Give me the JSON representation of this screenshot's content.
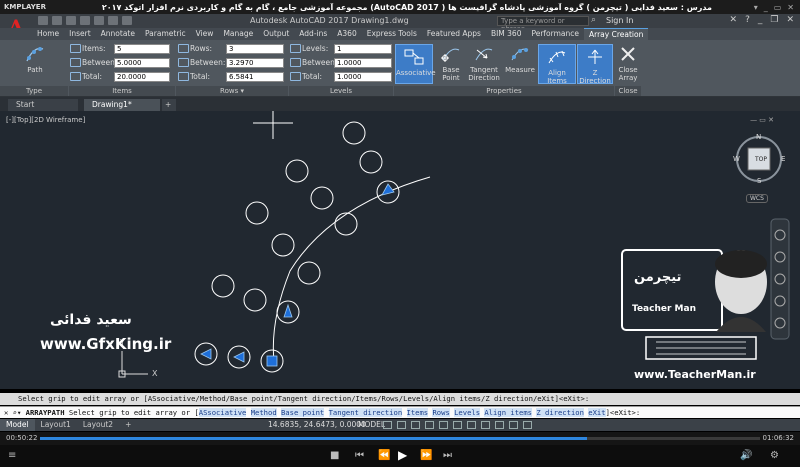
{
  "player": {
    "logo": "KMPLAYER",
    "title": "مجموعه آموزشی جامع ، گام به گام و کاربردی نرم افزار    اتوکد ۲۰۱۷ (AutoCAD 2017 )   مدرس : سعید فدایی ( تیچرمن ) گروه آموزشی پادشاه گرافیست ها",
    "time_elapsed": "00:50:22",
    "time_total": "01:06:32",
    "progress": 0.76
  },
  "acad": {
    "doc_title": "Autodesk AutoCAD 2017    Drawing1.dwg",
    "search_placeholder": "Type a keyword or phrase",
    "sign_in": "Sign In",
    "app_letter": "A"
  },
  "ribbon_tabs": [
    "Home",
    "Insert",
    "Annotate",
    "Parametric",
    "View",
    "Manage",
    "Output",
    "Add-ins",
    "A360",
    "Express Tools",
    "Featured Apps",
    "BIM 360",
    "Performance",
    "Array Creation"
  ],
  "active_tab": "Array Creation",
  "ribbon": {
    "type": {
      "button": "Path",
      "title": "Type"
    },
    "items": {
      "title": "Items",
      "items_label": "Items:",
      "items_value": "5",
      "between_label": "Between:",
      "between_value": "5.0000",
      "total_label": "Total:",
      "total_value": "20.0000"
    },
    "rows": {
      "title": "Rows ▾",
      "rows_label": "Rows:",
      "rows_value": "3",
      "between_label": "Between:",
      "between_value": "3.2970",
      "total_label": "Total:",
      "total_value": "6.5841"
    },
    "levels": {
      "title": "Levels",
      "levels_label": "Levels:",
      "levels_value": "1",
      "between_label": "Between:",
      "between_value": "1.0000",
      "total_label": "Total:",
      "total_value": "1.0000"
    },
    "properties": {
      "title": "Properties",
      "associative": "Associative",
      "base_point": "Base Point",
      "tangent_direction": "Tangent Direction",
      "measure": "Measure",
      "align_items": "Align Items",
      "z_direction": "Z Direction"
    },
    "close": {
      "button": "Close Array",
      "title": "Close"
    }
  },
  "doc_tabs": {
    "start": "Start",
    "drawing": "Drawing1*",
    "add": "+"
  },
  "viewport": {
    "label": "[-][Top][2D Wireframe]",
    "controls": "—  ▭  ✕",
    "viewcube_top": "TOP",
    "compass": {
      "n": "N",
      "s": "S",
      "e": "E",
      "w": "W"
    },
    "wcs": "WCS"
  },
  "command": {
    "history": "Select grip to edit array or [ASsociative/Method/Base point/Tangent direction/Items/Rows/Levels/Align items/Z direction/eXit]<eXit>:",
    "prompt_cmd": "ARRAYPATH",
    "prompt_text": "Select grip to edit array or",
    "options": [
      "ASsociative",
      "Method",
      "Base point",
      "Tangent direction",
      "Items",
      "Rows",
      "Levels",
      "Align items",
      "Z direction",
      "eXit"
    ],
    "suffix": "<eXit>:"
  },
  "status": {
    "tabs": [
      "Model",
      "Layout1",
      "Layout2"
    ],
    "coords": "14.6835, 24.6473, 0.0000",
    "mode": "MODEL"
  },
  "watermarks": {
    "left_site": "www.GfxKing.ir",
    "left_name_fa": "سعید فدائی",
    "right_site": "www.TeacherMan.ir",
    "right_name": "Teacher Man",
    "right_fa": "تیچرمن"
  },
  "axes": {
    "y": "Y",
    "x": "X"
  }
}
